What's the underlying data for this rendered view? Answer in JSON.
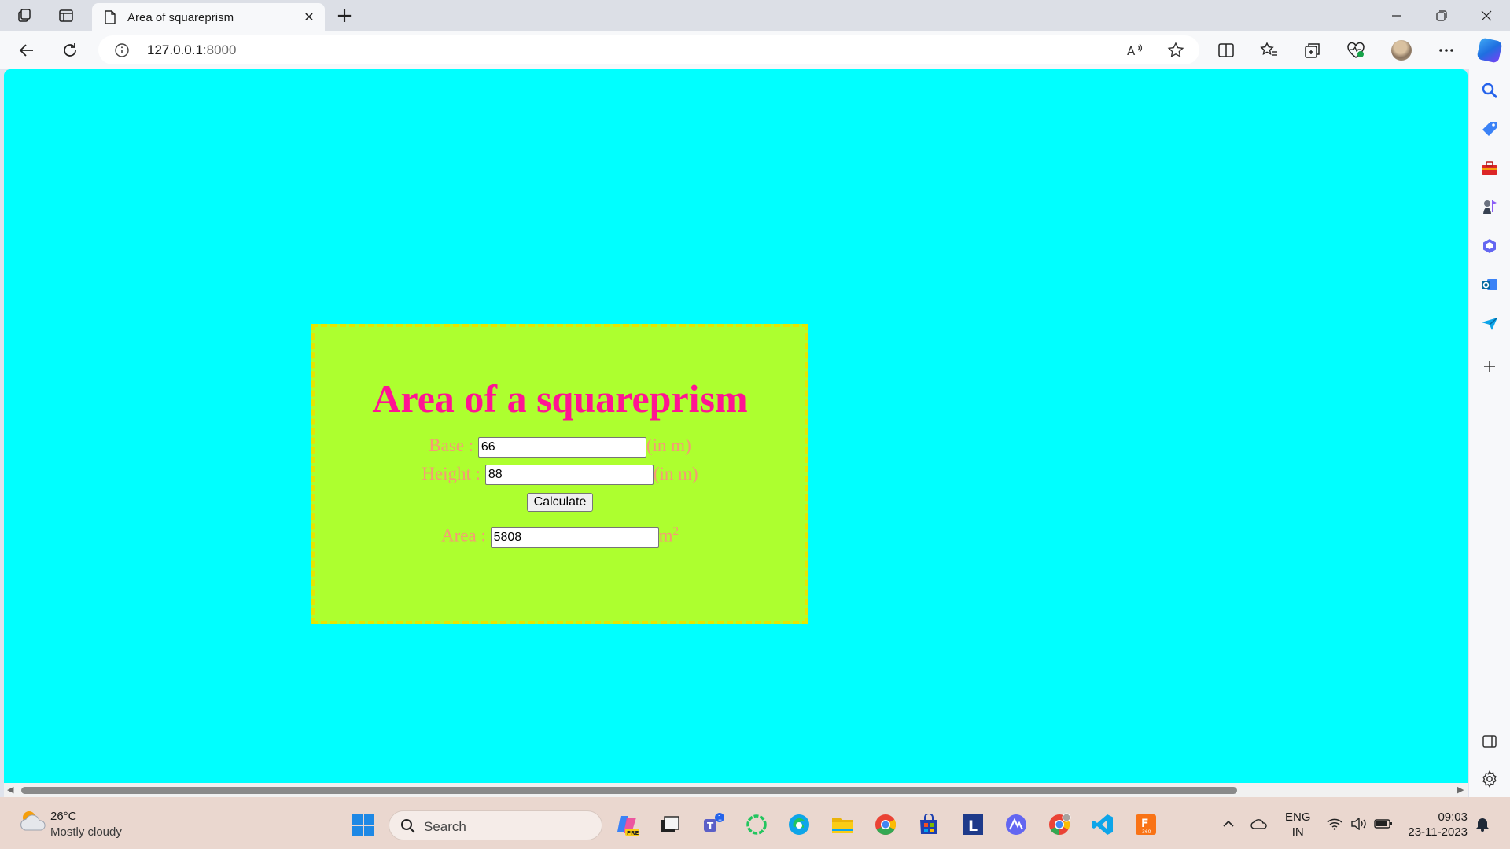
{
  "browser": {
    "tab_title": "Area of squareprism",
    "url_host": "127.0.0.1",
    "url_port": ":8000"
  },
  "page": {
    "heading": "Area of a squareprism",
    "base_label": "Base :",
    "base_value": "66",
    "base_unit": "(in m)",
    "height_label": "Height :",
    "height_value": "88",
    "height_unit": "(in m)",
    "calculate_label": "Calculate",
    "area_label": "Area :",
    "area_value": "5808",
    "area_unit": "m",
    "area_unit_exp": "2",
    "colors": {
      "background": "#00ffff",
      "card": "#adff2f",
      "card_border": "#e6e600",
      "heading": "#ff1493",
      "label": "#f69a76"
    }
  },
  "taskbar": {
    "temperature": "26°C",
    "weather": "Mostly cloudy",
    "search_placeholder": "Search",
    "teams_badge": "1",
    "lang_top": "ENG",
    "lang_bottom": "IN",
    "time": "09:03",
    "date": "23-11-2023"
  }
}
